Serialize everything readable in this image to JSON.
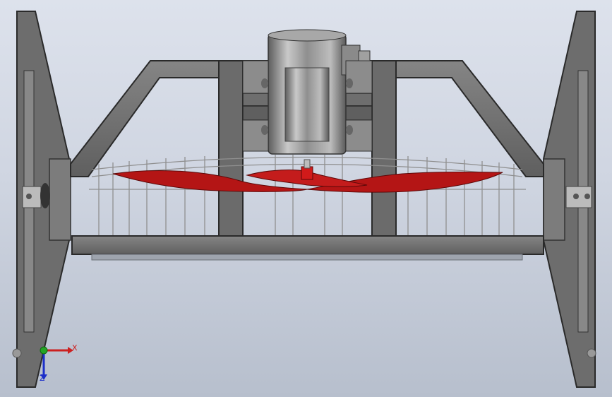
{
  "viewport": {
    "background_top": "#dde2ec",
    "background_bottom": "#b7bfcd"
  },
  "model": {
    "frame_color": "#6f6f6f",
    "frame_edge_color": "#2d2d2d",
    "motor_color": "#9a9a9a",
    "blade_color": "#b81414",
    "guard_wire_color": "#8c8c8c"
  },
  "triad": {
    "x_label": "X",
    "y_label": "Z",
    "x_color": "#cc2020",
    "y_color": "#1c2fc9",
    "origin_color": "#25a525"
  }
}
